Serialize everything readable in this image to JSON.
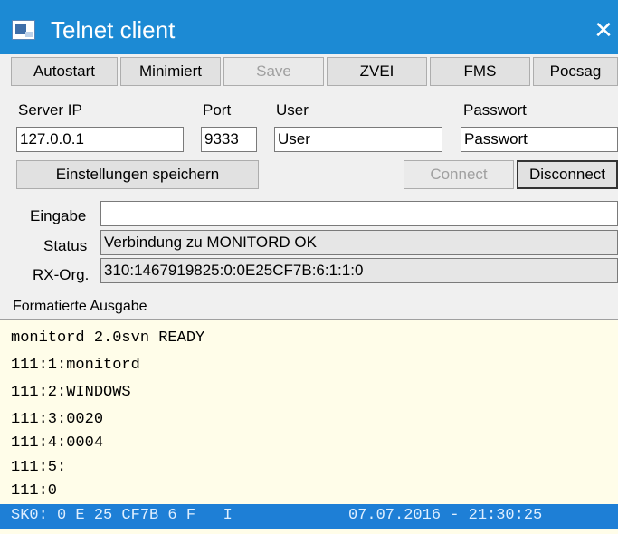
{
  "window": {
    "title": "Telnet client",
    "close_glyph": "✕"
  },
  "toolbar": [
    "Autostart",
    "Minimiert",
    "Save",
    "ZVEI",
    "FMS",
    "Pocsag"
  ],
  "connection": {
    "server_ip_label": "Server IP",
    "server_ip": "127.0.0.1",
    "port_label": "Port",
    "port": "9333",
    "user_label": "User",
    "user": "User",
    "password_label": "Passwort",
    "password": "Passwort"
  },
  "actions": {
    "save_settings": "Einstellungen speichern",
    "connect": "Connect",
    "disconnect": "Disconnect"
  },
  "fields": {
    "input_label": "Eingabe",
    "input_value": "",
    "status_label": "Status",
    "status_value": "Verbindung zu MONITORD OK",
    "rx_label": "RX-Org.",
    "rx_value": "310:1467919825:0:0E25CF7B:6:1:1:0"
  },
  "output": {
    "header": "Formatierte Ausgabe",
    "lines": [
      "monitord 2.0svn READY",
      "111:1:monitord",
      "111:2:WINDOWS",
      "111:3:0020",
      "111:4:0004",
      "111:5:",
      "111:0"
    ],
    "selected_line": "SK0: 0 E 25 CF7B 6 F   I",
    "selected_time": "07.07.2016 - 21:30:25"
  }
}
